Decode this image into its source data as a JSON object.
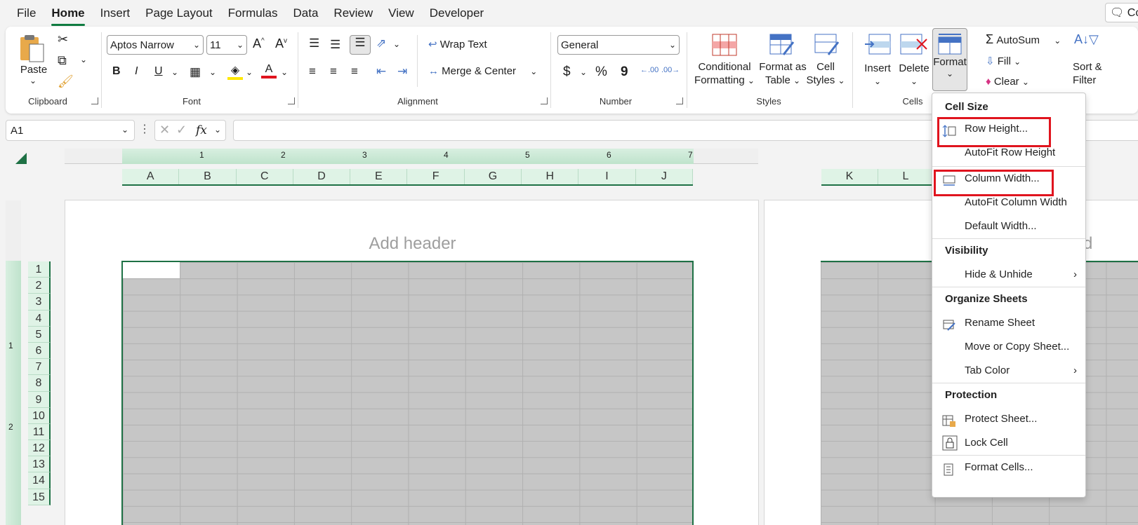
{
  "menu_tabs": [
    "File",
    "Home",
    "Insert",
    "Page Layout",
    "Formulas",
    "Data",
    "Review",
    "View",
    "Developer"
  ],
  "active_tab": "Home",
  "top_right_button": "Co",
  "clipboard": {
    "paste_label": "Paste",
    "group_label": "Clipboard"
  },
  "font": {
    "family": "Aptos Narrow",
    "size": "11",
    "group_label": "Font",
    "bold": "B",
    "italic": "I",
    "underline": "U"
  },
  "alignment": {
    "wrap_text": "Wrap Text",
    "merge_center": "Merge & Center",
    "group_label": "Alignment"
  },
  "number": {
    "format": "General",
    "currency": "$",
    "percent": "%",
    "comma": "9",
    "group_label": "Number"
  },
  "styles": {
    "conditional_1": "Conditional",
    "conditional_2": "Formatting",
    "format_table_1": "Format as",
    "format_table_2": "Table",
    "cell_styles_1": "Cell",
    "cell_styles_2": "Styles",
    "group_label": "Styles"
  },
  "cells": {
    "insert": "Insert",
    "delete": "Delete",
    "format": "Format",
    "group_label": "Cells"
  },
  "editing": {
    "autosum": "AutoSum",
    "fill": "Fill",
    "clear": "Clear",
    "sort_1": "Sort &",
    "sort_2": "Filter"
  },
  "formula_bar": {
    "name_box": "A1",
    "fx": "fx",
    "formula": ""
  },
  "ruler_ticks": [
    "1",
    "2",
    "3",
    "4",
    "5",
    "6",
    "7"
  ],
  "columns_left": [
    "A",
    "B",
    "C",
    "D",
    "E",
    "F",
    "G",
    "H",
    "I",
    "J"
  ],
  "columns_right": [
    "K",
    "L"
  ],
  "rows": [
    "1",
    "2",
    "3",
    "4",
    "5",
    "6",
    "7",
    "8",
    "9",
    "10",
    "11",
    "12",
    "13",
    "14",
    "15"
  ],
  "vruler": [
    "1",
    "2"
  ],
  "header_placeholder": "Add header",
  "header_placeholder_right": "d",
  "format_menu": {
    "cell_size": "Cell Size",
    "row_height": "Row Height...",
    "autofit_row": "AutoFit Row Height",
    "column_width": "Column Width...",
    "autofit_column": "AutoFit Column Width",
    "default_width": "Default Width...",
    "visibility": "Visibility",
    "hide_unhide": "Hide & Unhide",
    "organize": "Organize Sheets",
    "rename": "Rename Sheet",
    "move_copy": "Move or Copy Sheet...",
    "tab_color": "Tab Color",
    "protection": "Protection",
    "protect_sheet": "Protect Sheet...",
    "lock_cell": "Lock Cell",
    "format_cells": "Format Cells..."
  },
  "colors": {
    "excel_green": "#107c41",
    "highlight_red": "#e0141e",
    "header_green": "#dff3e6",
    "grid_gray": "#c6c6c6"
  }
}
